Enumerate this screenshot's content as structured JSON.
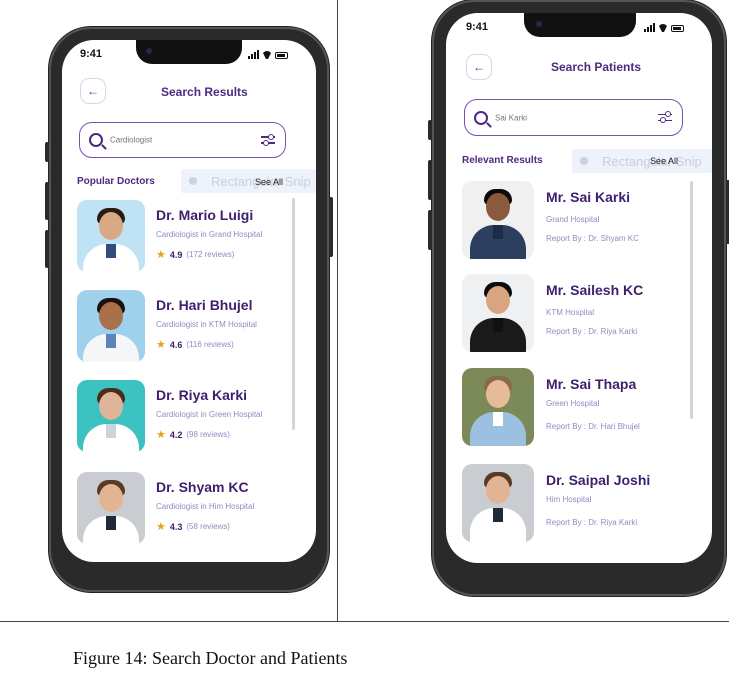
{
  "left_screen": {
    "status_time": "9:41",
    "back_icon": "back-arrow-icon",
    "title": "Search Results",
    "search_placeholder": "Cardiologist",
    "section_title": "Popular Doctors",
    "see_all": "See All",
    "overlay_text": "Rectangular Snip",
    "doctors": [
      {
        "name": "Dr. Mario Luigi",
        "specialty": "Cardiologist in Grand Hospital",
        "rating": "4.9",
        "reviews": "(172 reviews)"
      },
      {
        "name": "Dr. Hari Bhujel",
        "specialty": "Cardiologist in KTM Hospital",
        "rating": "4.6",
        "reviews": "(116 reviews)"
      },
      {
        "name": "Dr. Riya Karki",
        "specialty": "Cardiologist in Green Hospital",
        "rating": "4.2",
        "reviews": "(98 reviews)"
      },
      {
        "name": "Dr. Shyam KC",
        "specialty": "Cardiologist in Him Hospital",
        "rating": "4.3",
        "reviews": "(58 reviews)"
      }
    ]
  },
  "right_screen": {
    "status_time": "9:41",
    "title": "Search Patients",
    "search_placeholder": "Sai Karki",
    "section_title": "Relevant Results",
    "see_all": "See All",
    "overlay_text": "Rectangular Snip",
    "patients": [
      {
        "name": "Mr. Sai Karki",
        "hospital": "Grand Hospital",
        "report": "Report By : Dr. Shyam KC"
      },
      {
        "name": "Mr. Sailesh KC",
        "hospital": "KTM Hospital",
        "report": "Report By : Dr. Riya Karki"
      },
      {
        "name": "Mr. Sai Thapa",
        "hospital": "Green Hospital",
        "report": "Report By : Dr. Hari Bhujel"
      },
      {
        "name": "Dr. Saipal Joshi",
        "hospital": "Him Hospital",
        "report": "Report By : Dr. Riya Karki"
      }
    ]
  },
  "caption": "Figure 14: Search Doctor and Patients",
  "colors": {
    "accent": "#4d2a82",
    "star": "#e8a317",
    "muted": "#9c85c2"
  }
}
